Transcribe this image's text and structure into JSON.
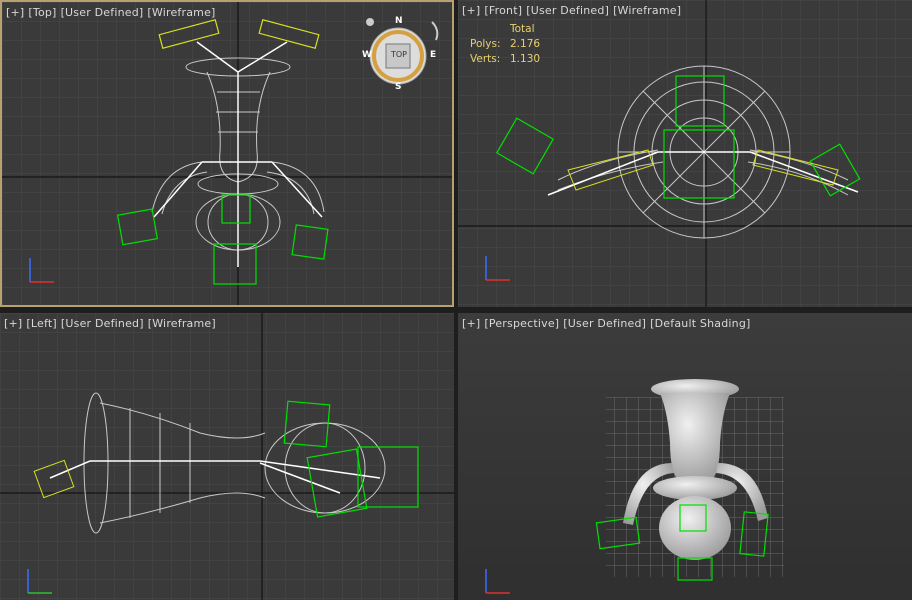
{
  "viewports": {
    "top": {
      "menu": "[+]",
      "view": "[Top]",
      "mode": "[User Defined]",
      "shading": "[Wireframe]"
    },
    "front": {
      "menu": "[+]",
      "view": "[Front]",
      "mode": "[User Defined]",
      "shading": "[Wireframe]"
    },
    "left": {
      "menu": "[+]",
      "view": "[Left]",
      "mode": "[User Defined]",
      "shading": "[Wireframe]"
    },
    "perspective": {
      "menu": "[+]",
      "view": "[Perspective]",
      "mode": "[User Defined]",
      "shading": "[Default Shading]"
    }
  },
  "stats": {
    "header": "Total",
    "polys_label": "Polys:",
    "polys_value": "2.176",
    "verts_label": "Verts:",
    "verts_value": "1.130"
  },
  "viewcube": {
    "face": "TOP",
    "n": "N",
    "s": "S",
    "e": "E",
    "w": "W"
  },
  "colors": {
    "grid": "#4a4a4a",
    "wire": "#c8c8c8",
    "bone_green": "#00e000",
    "bone_yellow": "#d8e020",
    "active_border": "#b8a070"
  }
}
